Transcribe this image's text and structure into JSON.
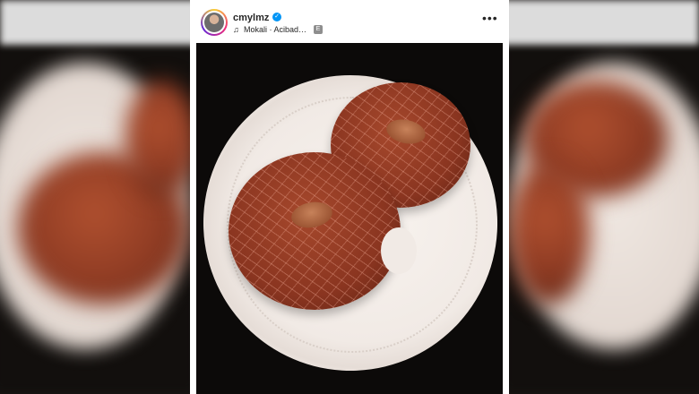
{
  "post": {
    "username": "cmylmz",
    "verified_icon": "verified-badge-icon",
    "audio": {
      "icon": "music-note-icon",
      "text": "Mokali · Acibad…"
    },
    "explicit_badge": "E",
    "more_icon": "more-options-icon",
    "more_label": "•••"
  },
  "colors": {
    "verified_blue": "#0095f6",
    "cookie": "#8a3520",
    "plate": "#f1eae5"
  }
}
